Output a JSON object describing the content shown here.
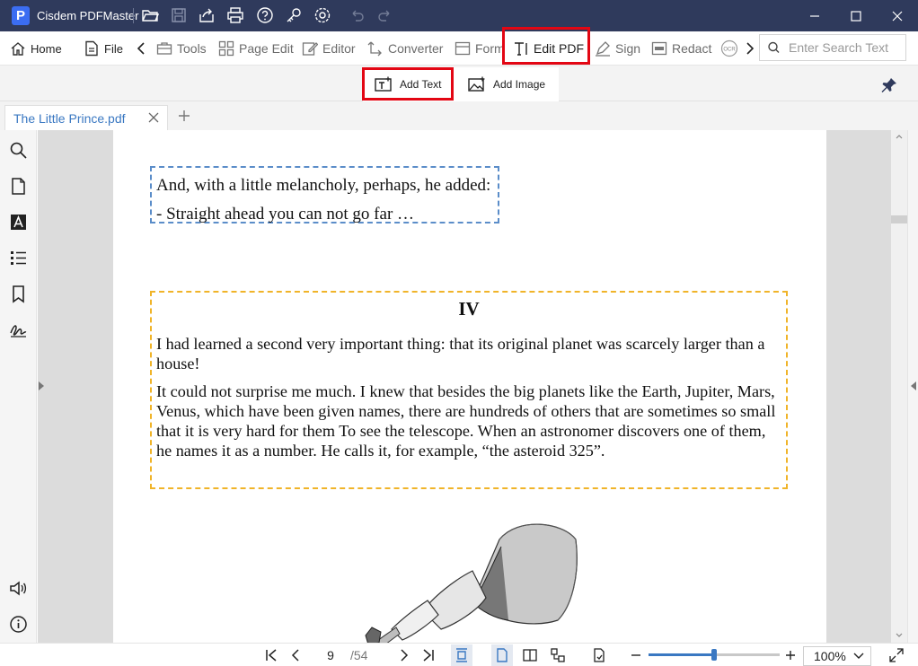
{
  "app": {
    "title": "Cisdem PDFMaster",
    "logo_letter": "P"
  },
  "toolbar": {
    "home": "Home",
    "file": "File",
    "tools": "Tools",
    "page_edit": "Page Edit",
    "editor": "Editor",
    "converter": "Converter",
    "form": "Form",
    "edit_pdf": "Edit PDF",
    "sign": "Sign",
    "redact": "Redact",
    "ocr": "OCR",
    "search_placeholder": "Enter Search Text"
  },
  "subtoolbar": {
    "add_text": "Add Text",
    "add_image": "Add Image"
  },
  "tab": {
    "name": "The Little Prince.pdf"
  },
  "document": {
    "block1": [
      "And, with a little melancholy, perhaps, he added:",
      "- Straight ahead you can not go far …"
    ],
    "block2": {
      "heading": "IV",
      "paragraphs": [
        "I had learned a second very important thing: that its original planet was scarcely larger than a house!",
        "It could not surprise me much. I knew that besides the big planets like the Earth, Jupiter, Mars, Venus, which have been given names, there are hundreds of others that are sometimes so small that it is very hard for them To see the telescope. When an astronomer discovers one of them, he names it as a number. He calls it, for example, “the asteroid 325”."
      ]
    }
  },
  "statusbar": {
    "page": "9",
    "total": "/54",
    "zoom": "100%",
    "zoom_level": 0.5
  },
  "colors": {
    "titlebar": "#2f3a5c",
    "highlight": "#e30613",
    "accent": "#3a78c2",
    "frame_blue": "#5b8dc9",
    "frame_orange": "#f0b429"
  },
  "icons": {
    "sidebar": [
      "search-icon",
      "page-icon",
      "text-icon",
      "list-icon",
      "bookmark-icon",
      "signature-icon",
      "speaker-icon",
      "info-icon"
    ]
  }
}
